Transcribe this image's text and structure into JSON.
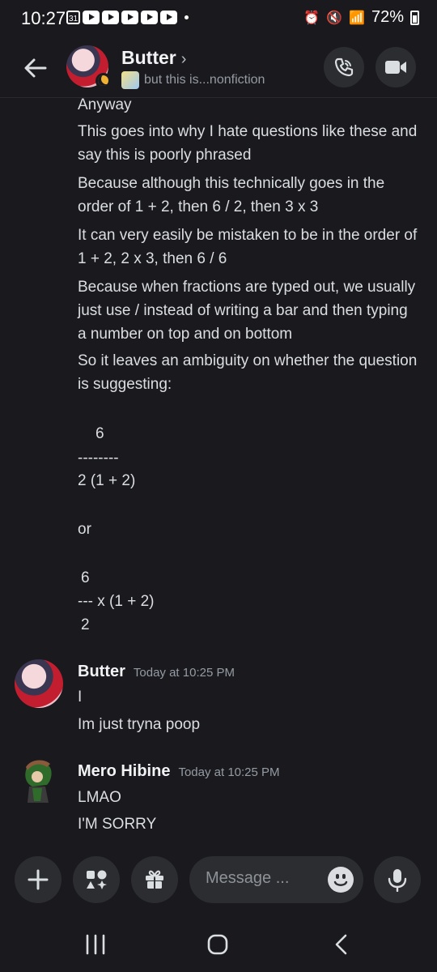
{
  "status_bar": {
    "time": "10:27",
    "calendar_day": "31",
    "battery": "72%"
  },
  "header": {
    "title": "Butter",
    "status_text": "but this is...nonfiction"
  },
  "messages": {
    "continued": [
      "Anyway",
      "This goes into why I hate questions like these and say this is poorly phrased",
      "Because although this technically goes in the order of 1 + 2, then 6 / 2, then 3 x 3",
      "It can very easily be mistaken to be in the order of 1 + 2, 2 x 3, then 6 / 6",
      "Because when fractions are typed out, we usually just use / instead of writing a bar and then typing a number on top and on bottom",
      "So it leaves an ambiguity on whether the question is suggesting:"
    ],
    "fraction_one": [
      "6",
      "--------",
      "2 (1 + 2)"
    ],
    "or": "or",
    "fraction_two": [
      "6",
      "--- x (1 + 2)",
      "2"
    ],
    "butter": {
      "name": "Butter",
      "timestamp": "Today at 10:25 PM",
      "lines": [
        "I",
        "Im just tryna poop"
      ]
    },
    "mero": {
      "name": "Mero Hibine",
      "timestamp": "Today at 10:25 PM",
      "lines": [
        "LMAO",
        "I'M SORRY"
      ]
    }
  },
  "composer": {
    "placeholder": "Message ..."
  },
  "colors": {
    "background": "#1a1a1e",
    "surface": "#2b2d31",
    "text": "#dbdee1",
    "muted": "#949ba4"
  }
}
